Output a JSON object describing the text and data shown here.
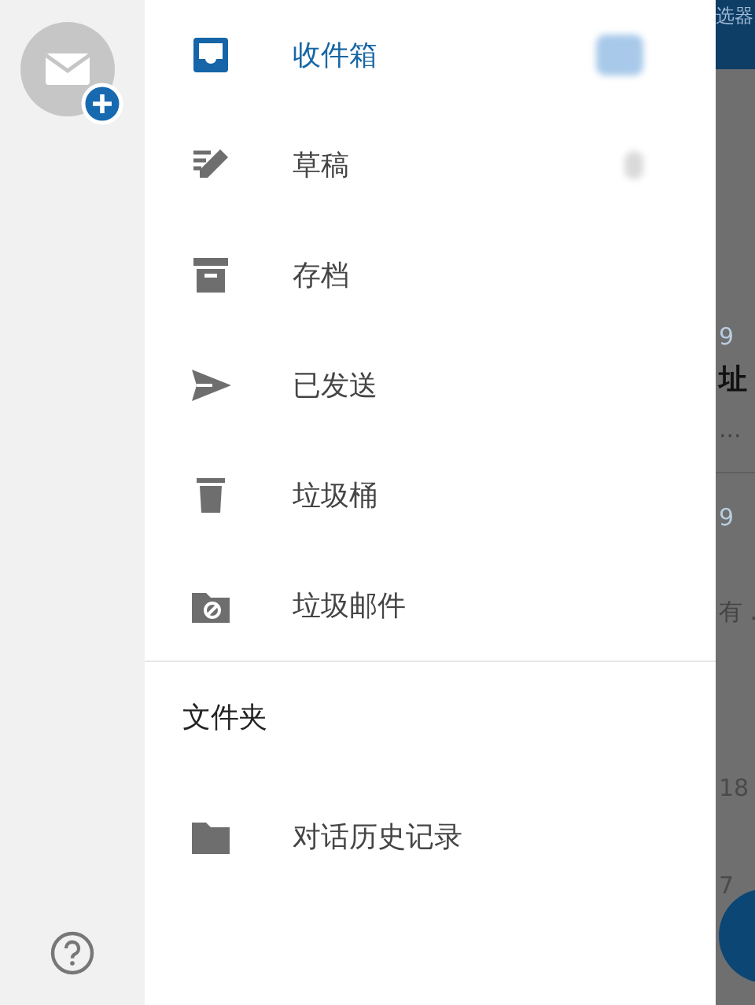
{
  "rail": {
    "account": {
      "kind": "add-account"
    },
    "help": {
      "kind": "help"
    }
  },
  "drawer": {
    "items": [
      {
        "label": "收件箱",
        "kind": "inbox",
        "selected": true,
        "count_hidden": true
      },
      {
        "label": "草稿",
        "kind": "drafts",
        "selected": false,
        "count_hidden": true
      },
      {
        "label": "存档",
        "kind": "archive",
        "selected": false
      },
      {
        "label": "已发送",
        "kind": "sent",
        "selected": false
      },
      {
        "label": "垃圾桶",
        "kind": "trash",
        "selected": false
      },
      {
        "label": "垃圾邮件",
        "kind": "junk",
        "selected": false
      }
    ],
    "section_title": "文件夹",
    "folders": [
      {
        "label": "对话历史记录",
        "kind": "folder",
        "selected": false
      }
    ]
  },
  "background": {
    "header": "选器",
    "texts": [
      {
        "text": "9",
        "kind": "date"
      },
      {
        "text": "址",
        "kind": "subject"
      },
      {
        "text": "...",
        "kind": "preview"
      },
      {
        "text": "9",
        "kind": "date"
      },
      {
        "text": "有 .",
        "kind": "preview"
      },
      {
        "text": "18",
        "kind": "time"
      },
      {
        "text": "7",
        "kind": "time"
      }
    ]
  }
}
